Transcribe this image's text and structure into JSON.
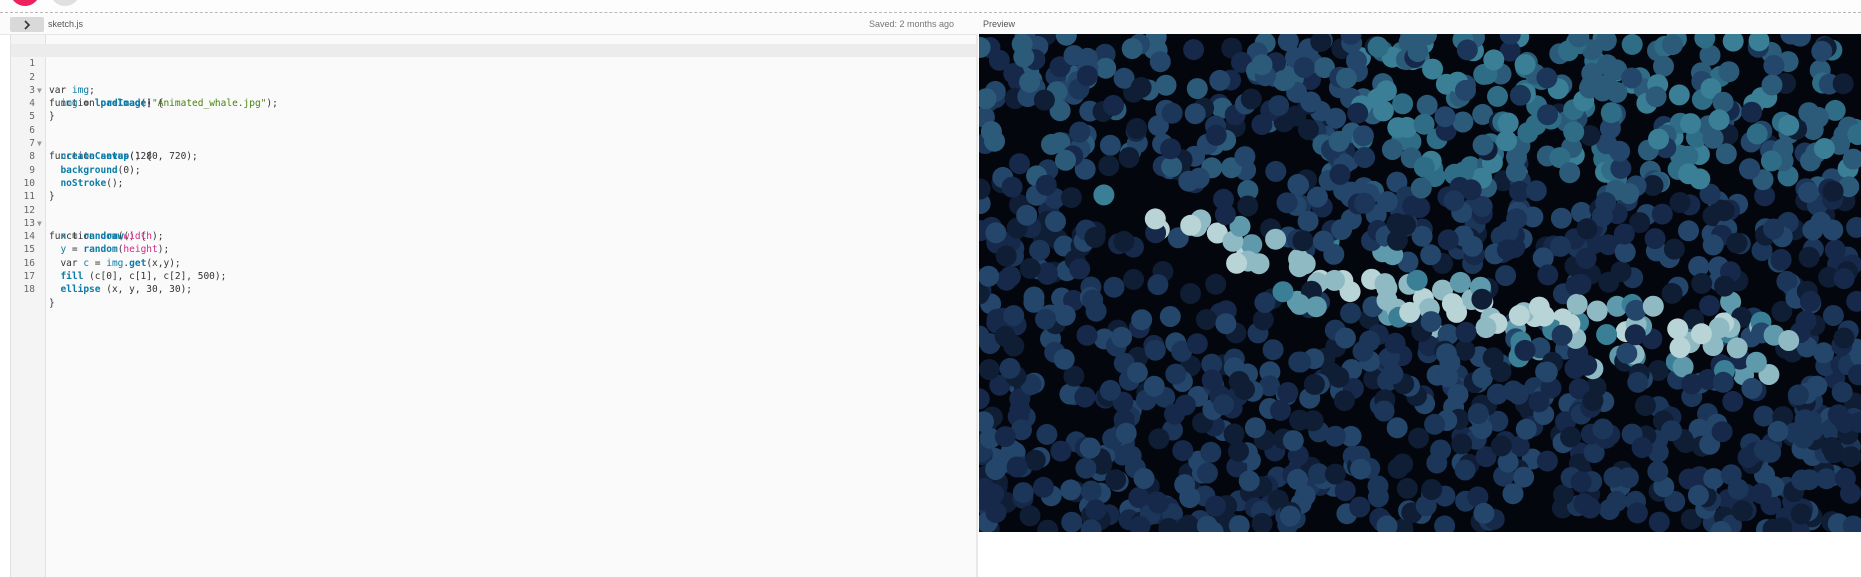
{
  "toolbar": {
    "play_button_color": "#ed225d",
    "stop_button_color": "#e0e0e0"
  },
  "editor": {
    "toggle_icon": "chevron-right-icon",
    "file_name": "sketch.js",
    "saved_status": "Saved: 2 months ago",
    "lines": [
      {
        "n": "1",
        "fold": ""
      },
      {
        "n": "2",
        "fold": "▼"
      },
      {
        "n": "3",
        "fold": ""
      },
      {
        "n": "4",
        "fold": ""
      },
      {
        "n": "5",
        "fold": ""
      },
      {
        "n": "6",
        "fold": "▼"
      },
      {
        "n": "7",
        "fold": ""
      },
      {
        "n": "8",
        "fold": ""
      },
      {
        "n": "9",
        "fold": ""
      },
      {
        "n": "10",
        "fold": ""
      },
      {
        "n": "11",
        "fold": ""
      },
      {
        "n": "12",
        "fold": "▼"
      },
      {
        "n": "13",
        "fold": ""
      },
      {
        "n": "14",
        "fold": ""
      },
      {
        "n": "15",
        "fold": ""
      },
      {
        "n": "16",
        "fold": ""
      },
      {
        "n": "17",
        "fold": ""
      },
      {
        "n": "18",
        "fold": ""
      }
    ],
    "code": {
      "l1": [
        "var ",
        "img",
        ";"
      ],
      "l2": [
        "function ",
        "preload",
        "() {"
      ],
      "l3": [
        "  ",
        "img",
        " = ",
        "loadImage",
        "(",
        "\"Animated_whale.jpg\"",
        ");"
      ],
      "l4": [
        "}"
      ],
      "l6": [
        "function ",
        "setup",
        "() {"
      ],
      "l7": [
        "  ",
        "createCanvas",
        "(1280, 720);"
      ],
      "l8": [
        "  ",
        "background",
        "(0);"
      ],
      "l9": [
        "  ",
        "noStroke",
        "();"
      ],
      "l10": [
        "}"
      ],
      "l12": [
        "function ",
        "draw",
        "() {"
      ],
      "l13": [
        "  ",
        "x",
        " = ",
        "random",
        "(",
        "width",
        ");"
      ],
      "l14": [
        "  ",
        "y",
        " = ",
        "random",
        "(",
        "height",
        ");"
      ],
      "l15": [
        "  var ",
        "c",
        " = ",
        "img",
        ".",
        "get",
        "(x,y);"
      ],
      "l16": [
        "  ",
        "fill",
        " (c[0], c[1], c[2], 500);"
      ],
      "l17": [
        "  ",
        "ellipse",
        " (x, y, 30, 30);"
      ],
      "l18": [
        "}"
      ]
    }
  },
  "preview": {
    "label": "Preview",
    "background_color": "#03060c",
    "palette": [
      "#0f1e35",
      "#16294a",
      "#1b3658",
      "#23466a",
      "#2c5b7a",
      "#2f6d86",
      "#3a7f95",
      "#5e9aab",
      "#8fbac4",
      "#b9d4d6"
    ]
  }
}
